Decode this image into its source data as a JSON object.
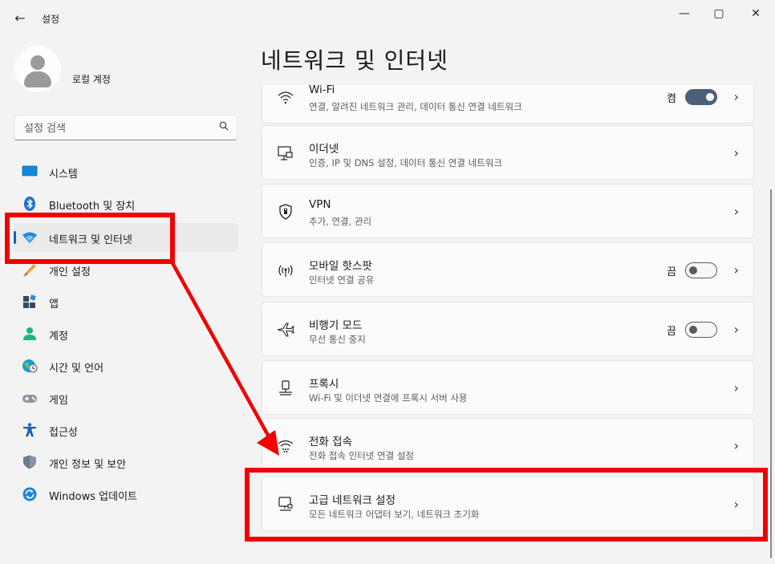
{
  "window": {
    "title": "설정",
    "back_glyph": "←",
    "minimize_glyph": "—",
    "maximize_glyph": "▢",
    "close_glyph": "✕"
  },
  "sidebar": {
    "user": {
      "name": "로컬 계정"
    },
    "search": {
      "placeholder": "설정 검색",
      "icon": "search-icon"
    },
    "items": [
      {
        "label": "시스템",
        "icon": "system-icon"
      },
      {
        "label": "Bluetooth 및 장치",
        "icon": "bluetooth-icon"
      },
      {
        "label": "네트워크 및 인터넷",
        "icon": "network-wifi-icon",
        "selected": true
      },
      {
        "label": "개인 설정",
        "icon": "personalization-brush-icon"
      },
      {
        "label": "앱",
        "icon": "apps-icon"
      },
      {
        "label": "계정",
        "icon": "accounts-person-icon"
      },
      {
        "label": "시간 및 언어",
        "icon": "time-language-icon"
      },
      {
        "label": "게임",
        "icon": "gaming-controller-icon"
      },
      {
        "label": "접근성",
        "icon": "accessibility-icon"
      },
      {
        "label": "개인 정보 및 보안",
        "icon": "privacy-shield-icon"
      },
      {
        "label": "Windows 업데이트",
        "icon": "windows-update-icon"
      }
    ]
  },
  "main": {
    "title": "네트워크 및 인터넷",
    "cards": [
      {
        "title": "Wi-Fi",
        "subtitle": "연결, 알려진 네트워크 관리, 데이터 통신 연결 네트워크",
        "icon": "wifi-icon",
        "toggle": "on",
        "toggle_label": "켬"
      },
      {
        "title": "이더넷",
        "subtitle": "인증, IP 및 DNS 설정, 데이터 통신 연결 네트워크",
        "icon": "ethernet-icon"
      },
      {
        "title": "VPN",
        "subtitle": "추가, 연결, 관리",
        "icon": "vpn-shield-icon"
      },
      {
        "title": "모바일 핫스팟",
        "subtitle": "인터넷 연결 공유",
        "icon": "hotspot-icon",
        "toggle": "off",
        "toggle_label": "끔"
      },
      {
        "title": "비행기 모드",
        "subtitle": "무선 통신 중지",
        "icon": "airplane-icon",
        "toggle": "off",
        "toggle_label": "끔"
      },
      {
        "title": "프록시",
        "subtitle": "Wi-Fi 및 이더넷 연결에 프록시 서버 사용",
        "icon": "proxy-icon"
      },
      {
        "title": "전화 접속",
        "subtitle": "전화 접속 인터넷 연결 설정",
        "icon": "dialup-icon"
      },
      {
        "title": "고급 네트워크 설정",
        "subtitle": "모든 네트워크 어댑터 보기, 네트워크 초기화",
        "icon": "advanced-network-icon"
      }
    ],
    "chevron_glyph": "›"
  },
  "annotation": {
    "color": "#f20000"
  }
}
